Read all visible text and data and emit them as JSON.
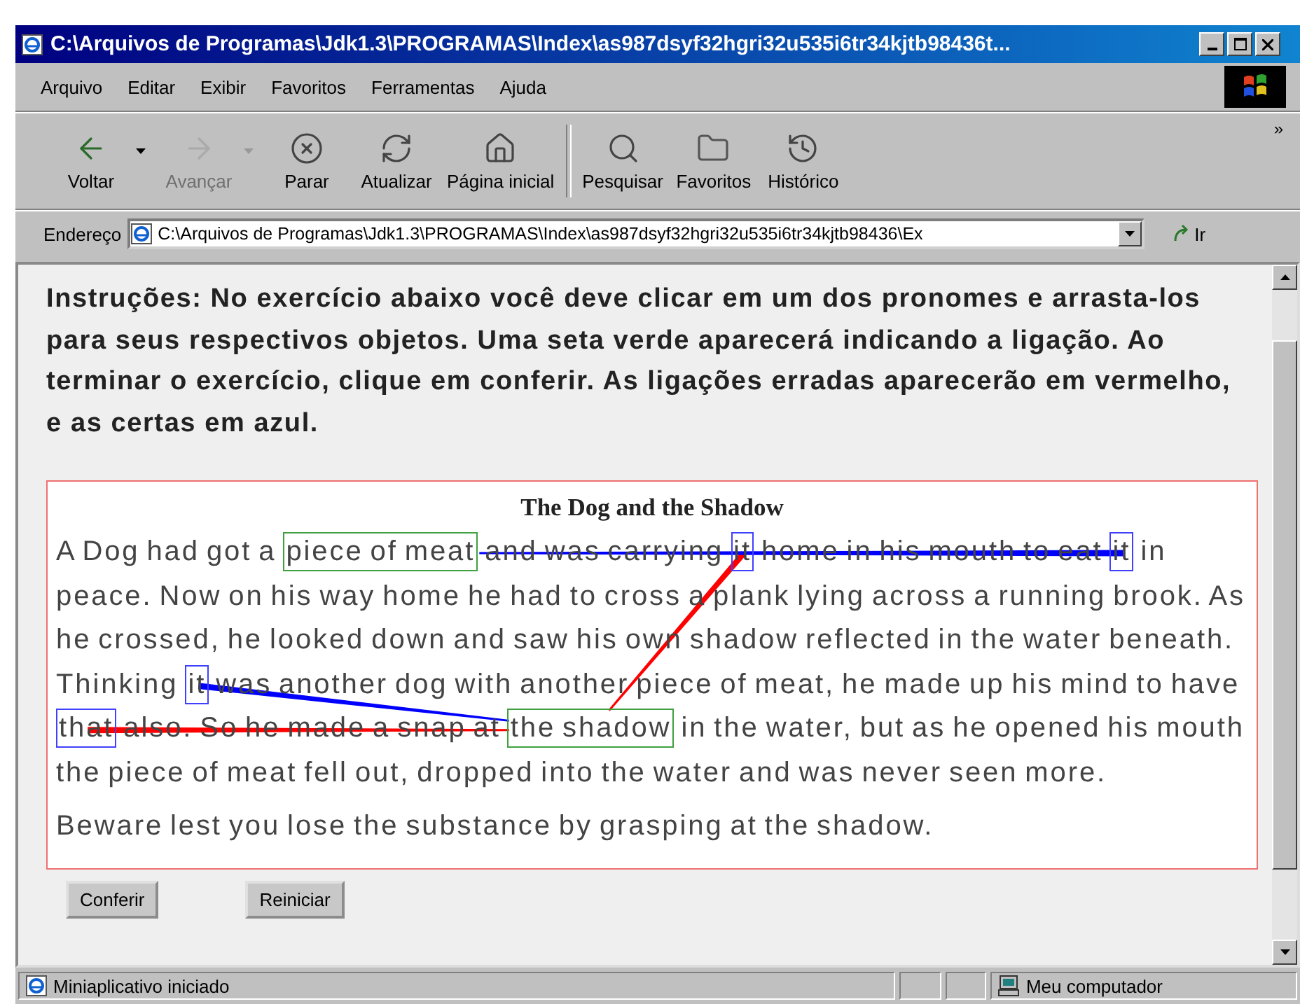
{
  "window": {
    "title": "C:\\Arquivos de Programas\\Jdk1.3\\PROGRAMAS\\Index\\as987dsyf32hgri32u535i6tr34kjtb98436t..."
  },
  "menu": [
    "Arquivo",
    "Editar",
    "Exibir",
    "Favoritos",
    "Ferramentas",
    "Ajuda"
  ],
  "toolbar": [
    {
      "label": "Voltar",
      "kind": "back",
      "disabled": false,
      "dropdown": true
    },
    {
      "label": "Avançar",
      "kind": "forward",
      "disabled": true,
      "dropdown": true
    },
    {
      "label": "Parar",
      "kind": "stop",
      "disabled": false,
      "dropdown": false
    },
    {
      "label": "Atualizar",
      "kind": "refresh",
      "disabled": false,
      "dropdown": false
    },
    {
      "label": "Página inicial",
      "kind": "home",
      "disabled": false,
      "dropdown": false
    },
    {
      "label": "Pesquisar",
      "kind": "search",
      "disabled": false,
      "dropdown": false
    },
    {
      "label": "Favoritos",
      "kind": "favorites",
      "disabled": false,
      "dropdown": false
    },
    {
      "label": "Histórico",
      "kind": "history",
      "disabled": false,
      "dropdown": false
    }
  ],
  "toolbar_more": "»",
  "address": {
    "label": "Endereço",
    "value": "C:\\Arquivos de Programas\\Jdk1.3\\PROGRAMAS\\Index\\as987dsyf32hgri32u535i6tr34kjtb98436\\Ex",
    "go": "Ir"
  },
  "instructions": "Instruções: No exercício abaixo você deve clicar em um dos pronomes e arrasta-los para seus respectivos objetos. Uma seta verde aparecerá indicando a ligação. Ao terminar o exercício, clique em conferir. As ligações erradas aparecerão em vermelho, e as certas em azul.",
  "story": {
    "title": "The Dog and the Shadow",
    "paragraphs": [
      {
        "segments": [
          {
            "text": "A Dog had got a "
          },
          {
            "text": "piece of meat",
            "kind": "object"
          },
          {
            "text": " and was carrying "
          },
          {
            "text": "it",
            "kind": "pronoun",
            "arrow": {
              "points_back": false,
              "correct": false
            }
          },
          {
            "text": " home in his mouth to eat "
          },
          {
            "text": "it",
            "kind": "pronoun",
            "arrow": {
              "points_back": true,
              "correct": true
            }
          },
          {
            "text": " in peace. Now on his way home he had to cross a plank lying across a running brook.  As he crossed, he looked down and saw his own shadow reflected in the water beneath. Thinking "
          },
          {
            "text": "it",
            "kind": "pronoun",
            "arrow": {
              "points_back": false,
              "correct": true
            }
          },
          {
            "text": " was another dog with another piece of meat, he made up his mind to have "
          },
          {
            "text": "that",
            "kind": "pronoun",
            "arrow": {
              "points_back": false,
              "correct": false
            }
          },
          {
            "text": " also.  So he made a snap at "
          },
          {
            "text": "the shadow",
            "kind": "object"
          },
          {
            "text": " in the water, but as he opened his mouth the piece of meat fell out, dropped into the water and was never seen more."
          }
        ]
      },
      {
        "segments": [
          {
            "text": "Beware lest you lose the substance by grasping at the shadow."
          }
        ]
      }
    ]
  },
  "buttons": [
    "Conferir",
    "Reiniciar"
  ],
  "status_bar": {
    "message": "Miniaplicativo iniciado",
    "zone": "Meu computador"
  }
}
